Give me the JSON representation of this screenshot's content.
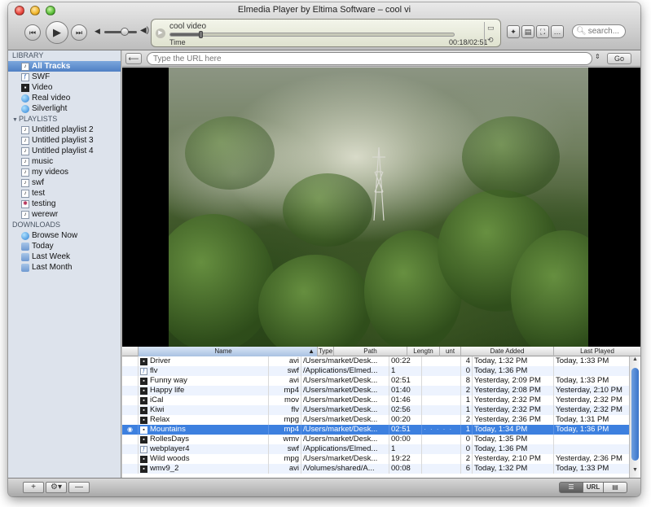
{
  "window": {
    "title": "Elmedia Player by Eltima Software – cool vi"
  },
  "toolbar": {
    "prev_icon": "⏮",
    "play_icon": "▶",
    "next_icon": "⏭",
    "lcd": {
      "title": "cool video",
      "label": "Time",
      "time": "00:18/02:51",
      "progress_fraction": 0.105
    },
    "pin_icon": "📌",
    "search_placeholder": "search..."
  },
  "sidebar": {
    "library_header": "LIBRARY",
    "library_items": [
      {
        "label": "All Tracks",
        "icon": "music-note-icon"
      },
      {
        "label": "SWF",
        "icon": "doc-icon"
      },
      {
        "label": "Video",
        "icon": "film-icon"
      },
      {
        "label": "Real video",
        "icon": "globe-icon"
      },
      {
        "label": "Silverlight",
        "icon": "globe-icon"
      }
    ],
    "playlists_header": "PLAYLISTS",
    "playlists": [
      "Untitled playlist 2",
      "Untitled playlist 3",
      "Untitled playlist 4",
      "music",
      "my videos",
      "swf",
      "test",
      "testing",
      "werewr"
    ],
    "downloads_header": "DOWNLOADS",
    "downloads": [
      "Browse Now",
      "Today",
      "Last Week",
      "Last Month"
    ]
  },
  "urlbar": {
    "placeholder": "Type the URL here",
    "go_label": "Go"
  },
  "table": {
    "columns": [
      "Name",
      "Type",
      "Path",
      "Lengtn",
      "unt",
      "Date Added",
      "Last Played"
    ],
    "rows": [
      {
        "name": "Driver",
        "type": "avi",
        "path": "/Users/market/Desk...",
        "length": "00:22",
        "count": "4",
        "date_added": "Today, 1:32 PM",
        "last_played": "Today, 1:33 PM",
        "icon": "film"
      },
      {
        "name": "flv",
        "type": "swf",
        "path": "/Applications/Elmed...",
        "length": "1",
        "count": "0",
        "date_added": "Today, 1:36 PM",
        "last_played": "",
        "icon": "doc"
      },
      {
        "name": "Funny way",
        "type": "avi",
        "path": "/Users/market/Desk...",
        "length": "02:51",
        "count": "8",
        "date_added": "Yesterday, 2:09 PM",
        "last_played": "Today, 1:33 PM",
        "icon": "film"
      },
      {
        "name": "Happy life",
        "type": "mp4",
        "path": "/Users/market/Desk...",
        "length": "01:40",
        "count": "2",
        "date_added": "Yesterday, 2:08 PM",
        "last_played": "Yesterday, 2:10 PM",
        "icon": "film"
      },
      {
        "name": "iCal",
        "type": "mov",
        "path": "/Users/market/Desk...",
        "length": "01:46",
        "count": "1",
        "date_added": "Yesterday, 2:32 PM",
        "last_played": "Yesterday, 2:32 PM",
        "icon": "film"
      },
      {
        "name": "Kiwi",
        "type": "flv",
        "path": "/Users/market/Desk...",
        "length": "02:56",
        "count": "1",
        "date_added": "Yesterday, 2:32 PM",
        "last_played": "Yesterday, 2:32 PM",
        "icon": "film"
      },
      {
        "name": "Relax",
        "type": "mpg",
        "path": "/Users/market/Desk...",
        "length": "00:20",
        "count": "2",
        "date_added": "Yesterday, 2:36 PM",
        "last_played": "Today, 1:31 PM",
        "icon": "film"
      },
      {
        "name": "Mountains",
        "type": "mp4",
        "path": "/Users/market/Desk...",
        "length": "02:51",
        "rating": "· · · · ·",
        "count": "1",
        "date_added": "Today, 1:34 PM",
        "last_played": "Today, 1:36 PM",
        "icon": "film",
        "selected": true,
        "indicator": "◉"
      },
      {
        "name": "RollesDays",
        "type": "wmv",
        "path": "/Users/market/Desk...",
        "length": "00:00",
        "count": "0",
        "date_added": "Today, 1:35 PM",
        "last_played": "",
        "icon": "film"
      },
      {
        "name": "webplayer4",
        "type": "swf",
        "path": "/Applications/Elmed...",
        "length": "1",
        "count": "0",
        "date_added": "Today, 1:36 PM",
        "last_played": "",
        "icon": "doc"
      },
      {
        "name": "Wild woods",
        "type": "mpg",
        "path": "/Users/market/Desk...",
        "length": "19:22",
        "count": "2",
        "date_added": "Yesterday, 2:10 PM",
        "last_played": "Yesterday, 2:36 PM",
        "icon": "film"
      },
      {
        "name": "wmv9_2",
        "type": "avi",
        "path": "/Volumes/shared/A...",
        "length": "00:08",
        "count": "6",
        "date_added": "Today, 1:32 PM",
        "last_played": "Today, 1:33 PM",
        "icon": "film"
      }
    ]
  },
  "bottombar": {
    "add_label": "+",
    "gear_label": "⚙▾",
    "remove_label": "—",
    "list_view": "☰",
    "url_view": "URL",
    "grid_view": "▤"
  },
  "colors": {
    "selection": "#3d80df",
    "sidebar_bg": "#dde3ec",
    "accent": "#4f7fc4"
  }
}
